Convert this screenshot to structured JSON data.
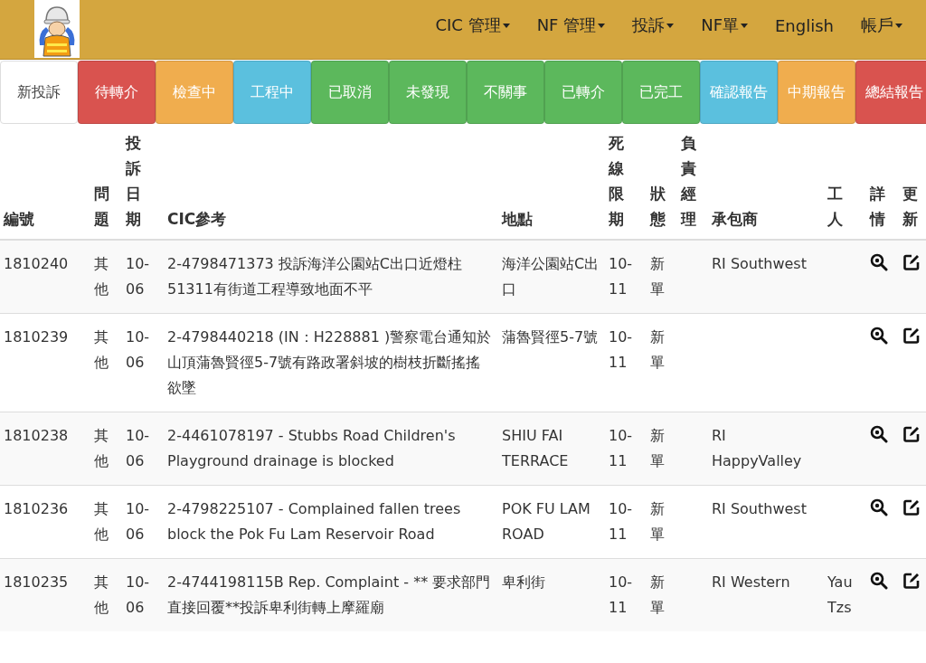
{
  "navbar": {
    "menus": [
      {
        "label": "CIC 管理",
        "dropdown": true
      },
      {
        "label": "NF 管理",
        "dropdown": true
      },
      {
        "label": "投訴",
        "dropdown": true
      },
      {
        "label": "NF單",
        "dropdown": true
      },
      {
        "label": "English",
        "dropdown": false
      },
      {
        "label": "帳戶",
        "dropdown": true
      }
    ]
  },
  "tabs": [
    {
      "label": "新投訴",
      "selected": true,
      "color": "#ffffff"
    },
    {
      "label": "待轉介",
      "selected": false,
      "color": "#d9534f"
    },
    {
      "label": "檢查中",
      "selected": false,
      "color": "#f0ad4e"
    },
    {
      "label": "工程中",
      "selected": false,
      "color": "#5bc0de"
    },
    {
      "label": "已取消",
      "selected": false,
      "color": "#5cb85c"
    },
    {
      "label": "未發現",
      "selected": false,
      "color": "#5cb85c"
    },
    {
      "label": "不關事",
      "selected": false,
      "color": "#5cb85c"
    },
    {
      "label": "已轉介",
      "selected": false,
      "color": "#5cb85c"
    },
    {
      "label": "已完工",
      "selected": false,
      "color": "#5cb85c"
    },
    {
      "label": "確認報告",
      "selected": false,
      "color": "#5bc0de"
    },
    {
      "label": "中期報告",
      "selected": false,
      "color": "#f0ad4e"
    },
    {
      "label": "總結報告",
      "selected": false,
      "color": "#d9534f"
    }
  ],
  "table": {
    "columns": [
      "編號",
      "問題",
      "投訴日期",
      "CIC參考",
      "地點",
      "死線限期",
      "狀態",
      "負責經理",
      "承包商",
      "工人",
      "詳情",
      "更新"
    ],
    "rows": [
      {
        "id": "1810240",
        "issue": "其他",
        "date": "10-06",
        "cic_ref": "2-4798471373 投訴海洋公園站C出口近燈柱51311有街道工程導致地面不平",
        "location": "海洋公園站C出口",
        "deadline": "10-11",
        "status": "新單",
        "manager": "",
        "contractor": "RI Southwest",
        "worker": ""
      },
      {
        "id": "1810239",
        "issue": "其他",
        "date": "10-06",
        "cic_ref": "2-4798440218 (IN：H228881 )警察電台通知於山頂蒲魯賢徑5-7號有路政署斜坡的樹枝折斷搖搖欲墜",
        "location": "蒲魯賢徑5-7號",
        "deadline": "10-11",
        "status": "新單",
        "manager": "",
        "contractor": "",
        "worker": ""
      },
      {
        "id": "1810238",
        "issue": "其他",
        "date": "10-06",
        "cic_ref": "2-4461078197 - Stubbs Road Children's Playground drainage is blocked",
        "location": "SHIU FAI TERRACE",
        "deadline": "10-11",
        "status": "新單",
        "manager": "",
        "contractor": "RI HappyValley",
        "worker": ""
      },
      {
        "id": "1810236",
        "issue": "其他",
        "date": "10-06",
        "cic_ref": "2-4798225107 - Complained fallen trees block the Pok Fu Lam Reservoir Road",
        "location": "POK FU LAM ROAD",
        "deadline": "10-11",
        "status": "新單",
        "manager": "",
        "contractor": "RI Southwest",
        "worker": ""
      },
      {
        "id": "1810235",
        "issue": "其他",
        "date": "10-06",
        "cic_ref": "2-4744198115B Rep. Complaint - ** 要求部門直接回覆**投訴卑利街轉上摩羅廟",
        "location": "卑利街",
        "deadline": "10-11",
        "status": "新單",
        "manager": "",
        "contractor": "RI Western",
        "worker": "Yau Tzs"
      }
    ]
  }
}
